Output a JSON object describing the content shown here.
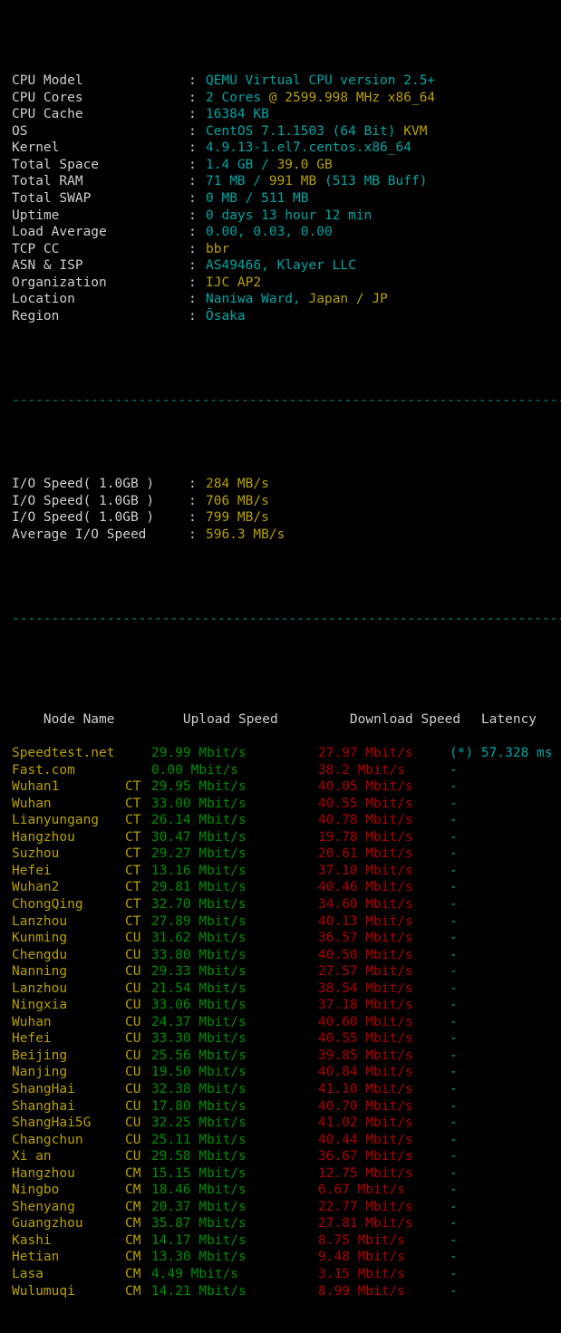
{
  "terminal": {
    "background": "#000000",
    "colors": {
      "label": "#cfcfcf",
      "cyan": "#00a6a6",
      "yellow": "#b8a000",
      "green": "#009000",
      "red": "#b00000",
      "separator": "#008f8f"
    },
    "separator_line": "----------------------------------------------------------------------"
  },
  "sysinfo": {
    "colon": ":",
    "rows": [
      {
        "label": "CPU Model",
        "value_primary": "QEMU Virtual CPU version 2.5+",
        "value_secondary": "",
        "tail": ""
      },
      {
        "label": "CPU Cores",
        "value_primary": "2 Cores",
        "value_secondary": " @ 2599.998 MHz x86_64",
        "tail": ""
      },
      {
        "label": "CPU Cache",
        "value_primary": "16384 KB",
        "value_secondary": "",
        "tail": ""
      },
      {
        "label": "OS",
        "value_primary": "CentOS 7.1.1503 (64 Bit) ",
        "value_secondary": "KVM",
        "tail": ""
      },
      {
        "label": "Kernel",
        "value_primary": "4.9.13-1.el7.centos.x86_64",
        "value_secondary": "",
        "tail": ""
      },
      {
        "label": "Total Space",
        "value_primary": "1.4 GB / ",
        "value_secondary": "39.0 GB",
        "tail": ""
      },
      {
        "label": "Total RAM",
        "value_primary": "71 MB / ",
        "value_secondary": "991 MB",
        "tail": " (513 MB Buff)"
      },
      {
        "label": "Total SWAP",
        "value_primary": "0 MB / 511 MB",
        "value_secondary": "",
        "tail": ""
      },
      {
        "label": "Uptime",
        "value_primary": "0 days 13 hour 12 min",
        "value_secondary": "",
        "tail": ""
      },
      {
        "label": "Load Average",
        "value_primary": "0.00, 0.03, 0.00",
        "value_secondary": "",
        "tail": ""
      },
      {
        "label": "TCP CC",
        "value_primary": "",
        "value_secondary": "bbr",
        "tail": ""
      },
      {
        "label": "ASN & ISP",
        "value_primary": "AS49466, Klayer LLC",
        "value_secondary": "",
        "tail": ""
      },
      {
        "label": "Organization",
        "value_primary": "",
        "value_secondary": "IJC AP2",
        "tail": ""
      },
      {
        "label": "Location",
        "value_primary": "Naniwa Ward, ",
        "value_secondary": "Japan / JP",
        "tail": ""
      },
      {
        "label": "Region",
        "value_primary": "Ōsaka",
        "value_secondary": "",
        "tail": ""
      }
    ]
  },
  "iospeed": {
    "colon": ":",
    "rows": [
      {
        "label": "I/O Speed( 1.0GB )",
        "value": "284 MB/s"
      },
      {
        "label": "I/O Speed( 1.0GB )",
        "value": "706 MB/s"
      },
      {
        "label": "I/O Speed( 1.0GB )",
        "value": "799 MB/s"
      },
      {
        "label": "Average I/O Speed",
        "value": "596.3 MB/s"
      }
    ]
  },
  "speedtest": {
    "headers": {
      "node": "Node Name",
      "isp": "",
      "upload": "Upload Speed",
      "download": "Download Speed",
      "latency": "Latency"
    },
    "rows": [
      {
        "node": "Speedtest.net",
        "isp": "",
        "upload": "29.99 Mbit/s",
        "download": "27.97 Mbit/s",
        "latency": "(*) 57.328 ms"
      },
      {
        "node": "Fast.com",
        "isp": "",
        "upload": "0.00 Mbit/s",
        "download": "38.2 Mbit/s",
        "latency": "-"
      },
      {
        "node": "Wuhan1",
        "isp": "CT",
        "upload": "29.95 Mbit/s",
        "download": "40.05 Mbit/s",
        "latency": "-"
      },
      {
        "node": "Wuhan",
        "isp": "CT",
        "upload": "33.00 Mbit/s",
        "download": "40.55 Mbit/s",
        "latency": "-"
      },
      {
        "node": "Lianyungang",
        "isp": "CT",
        "upload": "26.14 Mbit/s",
        "download": "40.78 Mbit/s",
        "latency": "-"
      },
      {
        "node": "Hangzhou",
        "isp": "CT",
        "upload": "30.47 Mbit/s",
        "download": "19.78 Mbit/s",
        "latency": "-"
      },
      {
        "node": "Suzhou",
        "isp": "CT",
        "upload": "29.27 Mbit/s",
        "download": "20.61 Mbit/s",
        "latency": "-"
      },
      {
        "node": "Hefei",
        "isp": "CT",
        "upload": "13.16 Mbit/s",
        "download": "37.10 Mbit/s",
        "latency": "-"
      },
      {
        "node": "Wuhan2",
        "isp": "CT",
        "upload": "29.81 Mbit/s",
        "download": "40.46 Mbit/s",
        "latency": "-"
      },
      {
        "node": "ChongQing",
        "isp": "CT",
        "upload": "32.70 Mbit/s",
        "download": "34.60 Mbit/s",
        "latency": "-"
      },
      {
        "node": "Lanzhou",
        "isp": "CT",
        "upload": "27.89 Mbit/s",
        "download": "40.13 Mbit/s",
        "latency": "-"
      },
      {
        "node": "Kunming",
        "isp": "CU",
        "upload": "31.62 Mbit/s",
        "download": "36.57 Mbit/s",
        "latency": "-"
      },
      {
        "node": "Chengdu",
        "isp": "CU",
        "upload": "33.80 Mbit/s",
        "download": "40.50 Mbit/s",
        "latency": "-"
      },
      {
        "node": "Nanning",
        "isp": "CU",
        "upload": "29.33 Mbit/s",
        "download": "27.57 Mbit/s",
        "latency": "-"
      },
      {
        "node": "Lanzhou",
        "isp": "CU",
        "upload": "21.54 Mbit/s",
        "download": "38.54 Mbit/s",
        "latency": "-"
      },
      {
        "node": "Ningxia",
        "isp": "CU",
        "upload": "33.06 Mbit/s",
        "download": "37.18 Mbit/s",
        "latency": "-"
      },
      {
        "node": "Wuhan",
        "isp": "CU",
        "upload": "24.37 Mbit/s",
        "download": "40.60 Mbit/s",
        "latency": "-"
      },
      {
        "node": "Hefei",
        "isp": "CU",
        "upload": "33.30 Mbit/s",
        "download": "40.55 Mbit/s",
        "latency": "-"
      },
      {
        "node": "Beijing",
        "isp": "CU",
        "upload": "25.56 Mbit/s",
        "download": "39.85 Mbit/s",
        "latency": "-"
      },
      {
        "node": "Nanjing",
        "isp": "CU",
        "upload": "19.50 Mbit/s",
        "download": "40.84 Mbit/s",
        "latency": "-"
      },
      {
        "node": "ShangHai",
        "isp": "CU",
        "upload": "32.38 Mbit/s",
        "download": "41.10 Mbit/s",
        "latency": "-"
      },
      {
        "node": "Shanghai",
        "isp": "CU",
        "upload": "17.80 Mbit/s",
        "download": "40.70 Mbit/s",
        "latency": "-"
      },
      {
        "node": "ShangHai5G",
        "isp": "CU",
        "upload": "32.25 Mbit/s",
        "download": "41.02 Mbit/s",
        "latency": "-"
      },
      {
        "node": "Changchun",
        "isp": "CU",
        "upload": "25.11 Mbit/s",
        "download": "40.44 Mbit/s",
        "latency": "-"
      },
      {
        "node": "Xi an",
        "isp": "CU",
        "upload": "29.58 Mbit/s",
        "download": "36.67 Mbit/s",
        "latency": "-"
      },
      {
        "node": "Hangzhou",
        "isp": "CM",
        "upload": "15.15 Mbit/s",
        "download": "12.75 Mbit/s",
        "latency": "-"
      },
      {
        "node": "Ningbo",
        "isp": "CM",
        "upload": "18.46 Mbit/s",
        "download": "6.67 Mbit/s",
        "latency": "-"
      },
      {
        "node": "Shenyang",
        "isp": "CM",
        "upload": "20.37 Mbit/s",
        "download": "22.77 Mbit/s",
        "latency": "-"
      },
      {
        "node": "Guangzhou",
        "isp": "CM",
        "upload": "35.87 Mbit/s",
        "download": "27.81 Mbit/s",
        "latency": "-"
      },
      {
        "node": "Kashi",
        "isp": "CM",
        "upload": "14.17 Mbit/s",
        "download": "8.75 Mbit/s",
        "latency": "-"
      },
      {
        "node": "Hetian",
        "isp": "CM",
        "upload": "13.30 Mbit/s",
        "download": "9.48 Mbit/s",
        "latency": "-"
      },
      {
        "node": "Lasa",
        "isp": "CM",
        "upload": "4.49 Mbit/s",
        "download": "3.15 Mbit/s",
        "latency": "-"
      },
      {
        "node": "Wulumuqi",
        "isp": "CM",
        "upload": "14.21 Mbit/s",
        "download": "8.99 Mbit/s",
        "latency": "-"
      }
    ]
  }
}
